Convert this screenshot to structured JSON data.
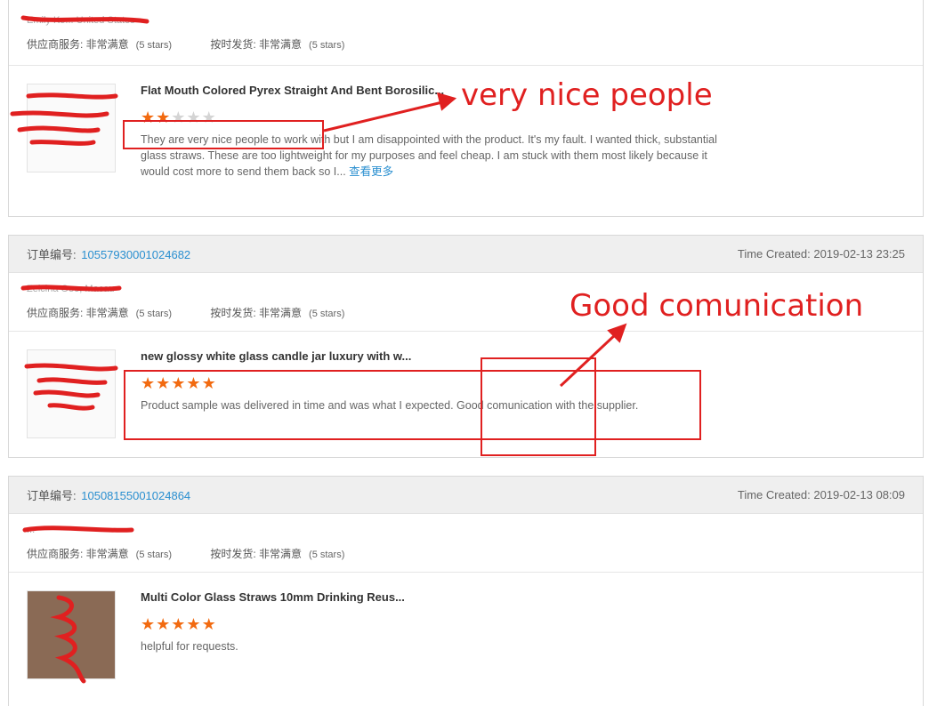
{
  "colors": {
    "accent": "#2a8fd0",
    "star": "#f26a10",
    "annotation": "#e02020"
  },
  "reviews": [
    {
      "buyer": "Emily Ko... United States",
      "supplier_service_label": "供应商服务: 非常满意",
      "supplier_service_stars": "(5 stars)",
      "on_time_label": "按时发货: 非常满意",
      "on_time_stars": "(5 stars)",
      "product_title": "Flat Mouth Colored Pyrex Straight And Bent Borosilic...",
      "rating": 2,
      "text": "They are very nice people to work with but I am disappointed with the product.  It's my fault.  I wanted thick, substantial glass straws.  These are too lightweight for my purposes and feel cheap.  I am stuck with them most likely because it would cost more to send them back so I...",
      "see_more": "查看更多"
    },
    {
      "order_label": "订单编号:",
      "order_number": "10557930001024682",
      "time_created": "Time Created: 2019-02-13 23:25",
      "buyer": "Zelcina Ooo, Macau",
      "supplier_service_label": "供应商服务: 非常满意",
      "supplier_service_stars": "(5 stars)",
      "on_time_label": "按时发货: 非常满意",
      "on_time_stars": "(5 stars)",
      "product_title": "new glossy white glass candle jar luxury with w...",
      "rating": 5,
      "text": "Product sample was delivered in time and was what I expected. Good comunication with the supplier."
    },
    {
      "order_label": "订单编号:",
      "order_number": "10508155001024864",
      "time_created": "Time Created: 2019-02-13 08:09",
      "buyer": "...",
      "supplier_service_label": "供应商服务: 非常满意",
      "supplier_service_stars": "(5 stars)",
      "on_time_label": "按时发货: 非常满意",
      "on_time_stars": "(5 stars)",
      "product_title": "Multi Color Glass Straws 10mm Drinking Reus...",
      "rating": 5,
      "text": "helpful for requests."
    }
  ],
  "annotations": {
    "note_1": "very nice people",
    "note_2": "Good comunication"
  }
}
